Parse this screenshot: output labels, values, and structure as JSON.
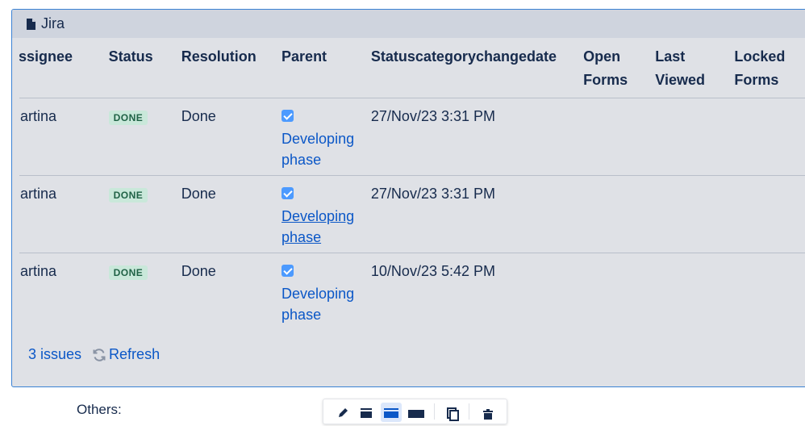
{
  "macro": {
    "title": "Jira",
    "icon": "document-icon"
  },
  "table": {
    "headers": {
      "assignee": "Assignee",
      "status": "Status",
      "resolution": "Resolution",
      "parent": "Parent",
      "statuscategorychangedate": "Statuscategorychangedate",
      "open_forms_1": "Open",
      "open_forms_2": "Forms",
      "last_viewed_1": "Last",
      "last_viewed_2": "Viewed",
      "locked_forms_1": "Locked",
      "locked_forms_2": "Forms"
    },
    "rows": [
      {
        "assignee": "Martina",
        "status": "DONE",
        "resolution": "Done",
        "parent_line1": "Developing",
        "parent_line2": "phase",
        "date": "27/Nov/23 3:31 PM"
      },
      {
        "assignee": "Martina",
        "status": "DONE",
        "resolution": "Done",
        "parent_line1": "Developing",
        "parent_line2": "phase",
        "date": "27/Nov/23 3:31 PM"
      },
      {
        "assignee": "Martina",
        "status": "DONE",
        "resolution": "Done",
        "parent_line1": "Developing",
        "parent_line2": "phase",
        "date": "10/Nov/23 5:42 PM"
      }
    ]
  },
  "footer": {
    "issues_count": "3 issues",
    "refresh_label": "Refresh"
  },
  "below": {
    "others_label": "Others:"
  },
  "colors": {
    "accent": "#0b57c7",
    "done_badge_bg": "#c9e8da",
    "done_badge_text": "#206246",
    "checkbox": "#4c9aff"
  }
}
